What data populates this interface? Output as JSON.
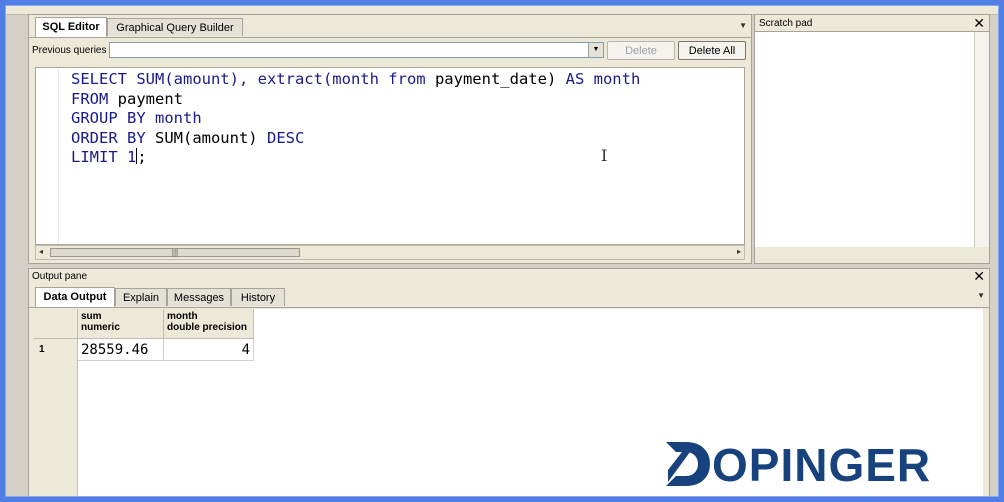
{
  "editor": {
    "tabs": [
      {
        "label": "SQL Editor",
        "active": true
      },
      {
        "label": "Graphical Query Builder",
        "active": false
      }
    ],
    "previous_queries_label": "Previous queries",
    "previous_queries_value": "",
    "delete_label": "Delete",
    "delete_all_label": "Delete All",
    "code": {
      "l1_a": "SELECT SUM(amount), ",
      "l1_b": "extract(month from",
      "l1_c": " payment_date) ",
      "l1_d": "AS",
      "l1_e": " month",
      "l2_a": "FROM",
      "l2_b": " payment",
      "l3_a": "GROUP BY",
      "l3_b": " month",
      "l4_a": "ORDER BY",
      "l4_b": " SUM(amount) ",
      "l4_c": "DESC",
      "l5_a": "LIMIT",
      "l5_b": " 1",
      "l5_c": ";"
    }
  },
  "scratch": {
    "title": "Scratch pad",
    "close": "✕"
  },
  "output": {
    "title": "Output pane",
    "close": "✕",
    "tabs": [
      {
        "label": "Data Output",
        "active": true
      },
      {
        "label": "Explain",
        "active": false
      },
      {
        "label": "Messages",
        "active": false
      },
      {
        "label": "History",
        "active": false
      }
    ],
    "columns": [
      {
        "name": "sum",
        "type": "numeric"
      },
      {
        "name": "month",
        "type": "double precision"
      }
    ],
    "rows": [
      {
        "num": "1",
        "sum": "28559.46",
        "month": "4"
      }
    ]
  },
  "logo": {
    "text": "DOPINGER",
    "visible_text": "OPINGER",
    "color": "#17427d"
  },
  "colors": {
    "background_frame": "#4f7fe6",
    "keyword": "#1a1a8a"
  }
}
